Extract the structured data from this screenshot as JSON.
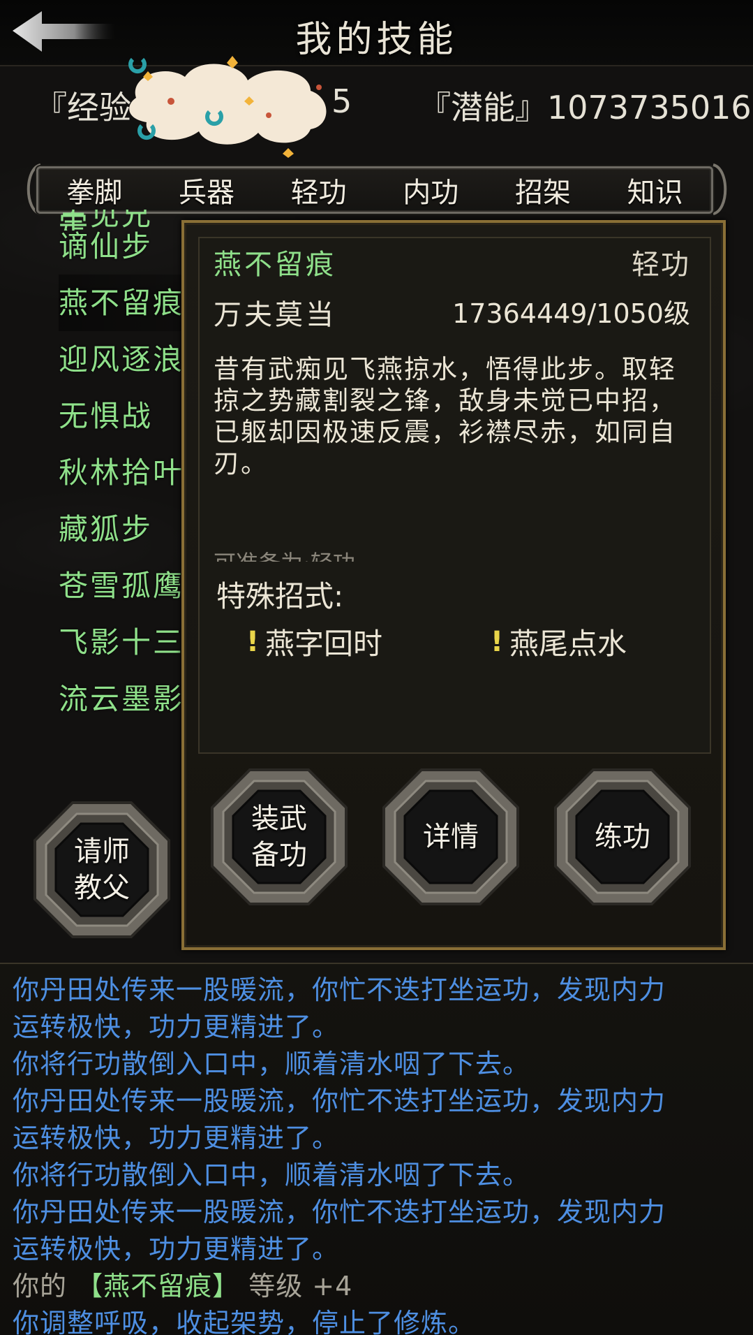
{
  "header": {
    "title": "我的技能"
  },
  "stats": {
    "exp_label": "『经验",
    "exp_tail": "5",
    "potential": "『潜能』1073735016"
  },
  "tabs": [
    {
      "label": "拳脚",
      "active": false
    },
    {
      "label": "兵器",
      "active": false
    },
    {
      "label": "轻功",
      "active": true
    },
    {
      "label": "内功",
      "active": false
    },
    {
      "label": "招架",
      "active": false
    },
    {
      "label": "知识",
      "active": false
    }
  ],
  "skill_list": {
    "cut_top": "王见兄定",
    "items": [
      "谪仙步",
      "燕不留痕",
      "迎风逐浪",
      "无惧战",
      "秋林拾叶",
      "藏狐步",
      "苍雪孤鹰",
      "飞影十三",
      "流云墨影"
    ]
  },
  "detail": {
    "name": "燕不留痕",
    "type": "轻功",
    "rank": "万夫莫当",
    "level": "17364449/1050级",
    "description": "昔有武痴见飞燕掠水，悟得此步。取轻掠之势藏割裂之锋，敌身未觉已中招，已躯却因极速反震，衫襟尽赤，如同自刃。",
    "extra": "可准备为:轻功",
    "special_label": "特殊招式:",
    "moves": [
      "燕字回时",
      "燕尾点水"
    ]
  },
  "buttons": {
    "teacher": "请师\n教父",
    "equip": "装武\n备功",
    "details": "详情",
    "practice": "练功"
  },
  "log": {
    "line1": "你丹田处传来一股暖流，你忙不迭打坐运功，发现内力",
    "line2": "运转极快，功力更精进了。",
    "line3": "你将行功散倒入口中，顺着清水咽了下去。",
    "line4": "你丹田处传来一股暖流，你忙不迭打坐运功，发现内力",
    "line5": "运转极快，功力更精进了。",
    "line6": "你将行功散倒入口中，顺着清水咽了下去。",
    "line7": "你丹田处传来一股暖流，你忙不迭打坐运功，发现内力",
    "line8": "运转极快，功力更精进了。",
    "line9_prefix": "你的",
    "line9_skill": "【燕不留痕】",
    "line9_suffix": "等级 +4",
    "line10": "你调整呼吸，收起架势，停止了修炼。"
  },
  "colors": {
    "skill_green": "#8fe08a",
    "log_blue": "#4e8fe2",
    "panel_gold": "#8a6f36",
    "highlight_yellow": "#e9d54a"
  }
}
